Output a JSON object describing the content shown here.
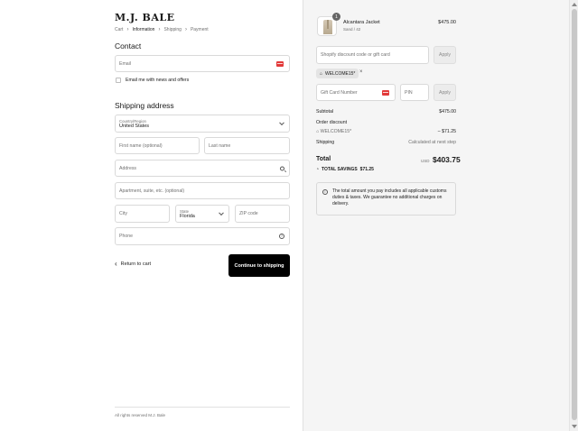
{
  "brand": {
    "logo": "M.J. BALE"
  },
  "breadcrumbs": [
    "Cart",
    "Information",
    "Shipping",
    "Payment"
  ],
  "contact": {
    "heading": "Contact",
    "email_placeholder": "Email",
    "newsletter_label": "Email me with news and offers"
  },
  "shipping": {
    "heading": "Shipping address",
    "country_label": "Country/Region",
    "country_value": "United States",
    "first_name_placeholder": "First name (optional)",
    "last_name_placeholder": "Last name",
    "address_placeholder": "Address",
    "apartment_placeholder": "Apartment, suite, etc. (optional)",
    "city_placeholder": "City",
    "state_label": "State",
    "state_value": "Florida",
    "zip_placeholder": "ZIP code",
    "phone_placeholder": "Phone"
  },
  "actions": {
    "return_label": "Return to cart",
    "continue_label": "Continue to shipping"
  },
  "footer": "All rights reserved M.J. Bale",
  "order": {
    "item": {
      "name": "Alcantara Jacket",
      "variant": "Sand / 42",
      "price": "$475.00",
      "quantity": "1"
    },
    "discount_placeholder": "Shopify discount code or gift card",
    "apply_label": "Apply",
    "applied_code": "WELCOME15*",
    "gift_card_placeholder": "Gift Card Number",
    "pin_placeholder": "PIN",
    "subtotal_label": "Subtotal",
    "subtotal_value": "$475.00",
    "order_discount_label": "Order discount",
    "discount_code": "WELCOME15*",
    "discount_value": "– $71.25",
    "shipping_label": "Shipping",
    "shipping_value": "Calculated at next step",
    "total_label": "Total",
    "currency": "USD",
    "total_value": "$403.75",
    "savings_label": "TOTAL SAVINGS",
    "savings_value": "$71.25",
    "info_text": "The total amount you pay includes all applicable customs duties & taxes. We guarantee no additional charges on delivery."
  },
  "colors": {
    "button_bg": "#000000",
    "card_badge": "#e23a3a",
    "panel_bg": "#f5f5f5"
  }
}
